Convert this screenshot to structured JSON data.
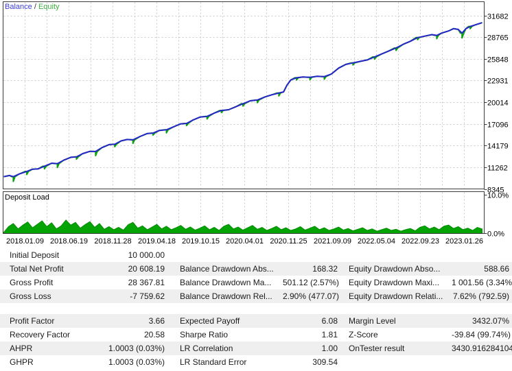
{
  "legend": {
    "balance": "Balance",
    "separator": " / ",
    "equity": "Equity"
  },
  "deposit_panel": {
    "label": "Deposit Load",
    "axis_max_label": "10.0%",
    "axis_min_label": "0.0%"
  },
  "colors": {
    "balance_line": "#2525c8",
    "equity_line": "#0ba30b",
    "deposit_fill": "#04a404",
    "deposit_edge": "#078a07",
    "grid": "#c9c9c9",
    "border": "#3a3a3a",
    "axis_text": "#000000",
    "legend_balance": "#3a3ad9",
    "legend_equity": "#3fae3f",
    "row_alt_bg": "#efefef"
  },
  "chart_data": {
    "type": "line",
    "title": "Balance / Equity",
    "legend": [
      "Balance",
      "Equity"
    ],
    "legend_position": "top-left",
    "grid": "on",
    "y_ticks": [
      31682,
      28765,
      25848,
      22931,
      20014,
      17096,
      14179,
      11262,
      8345
    ],
    "y_range": [
      8345,
      31682
    ],
    "x_tick_dates": [
      "2018.01.09",
      "2018.06.19",
      "2018.11.28",
      "2019.04.18",
      "2019.10.15",
      "2020.04.01",
      "2020.11.25",
      "2021.09.09",
      "2022.05.04",
      "2022.09.23",
      "2023.01.26"
    ],
    "initial_value": 10000,
    "final_balance": 30608,
    "balance_points": [
      [
        0,
        10000
      ],
      [
        0.012,
        10150
      ],
      [
        0.02,
        10000
      ],
      [
        0.032,
        10350
      ],
      [
        0.048,
        10700
      ],
      [
        0.06,
        11000
      ],
      [
        0.072,
        11050
      ],
      [
        0.085,
        11400
      ],
      [
        0.1,
        11800
      ],
      [
        0.112,
        11750
      ],
      [
        0.125,
        12200
      ],
      [
        0.14,
        12600
      ],
      [
        0.152,
        12650
      ],
      [
        0.165,
        13100
      ],
      [
        0.18,
        13400
      ],
      [
        0.192,
        13380
      ],
      [
        0.205,
        13900
      ],
      [
        0.22,
        14300
      ],
      [
        0.232,
        14350
      ],
      [
        0.245,
        14800
      ],
      [
        0.258,
        15000
      ],
      [
        0.27,
        14950
      ],
      [
        0.285,
        15400
      ],
      [
        0.3,
        15800
      ],
      [
        0.312,
        15850
      ],
      [
        0.325,
        16200
      ],
      [
        0.34,
        16300
      ],
      [
        0.355,
        16700
      ],
      [
        0.37,
        17100
      ],
      [
        0.382,
        17150
      ],
      [
        0.395,
        17600
      ],
      [
        0.41,
        18000
      ],
      [
        0.425,
        18100
      ],
      [
        0.44,
        18550
      ],
      [
        0.455,
        18900
      ],
      [
        0.47,
        19000
      ],
      [
        0.485,
        19400
      ],
      [
        0.5,
        19800
      ],
      [
        0.515,
        20200
      ],
      [
        0.53,
        20300
      ],
      [
        0.545,
        20700
      ],
      [
        0.56,
        21000
      ],
      [
        0.575,
        21250
      ],
      [
        0.585,
        21400
      ],
      [
        0.592,
        22300
      ],
      [
        0.6,
        23000
      ],
      [
        0.612,
        23300
      ],
      [
        0.625,
        23400
      ],
      [
        0.64,
        23350
      ],
      [
        0.655,
        23500
      ],
      [
        0.67,
        23450
      ],
      [
        0.685,
        23800
      ],
      [
        0.7,
        24600
      ],
      [
        0.715,
        25100
      ],
      [
        0.73,
        25300
      ],
      [
        0.745,
        25500
      ],
      [
        0.76,
        25700
      ],
      [
        0.775,
        26100
      ],
      [
        0.79,
        26500
      ],
      [
        0.805,
        26900
      ],
      [
        0.82,
        27300
      ],
      [
        0.835,
        27800
      ],
      [
        0.85,
        28200
      ],
      [
        0.865,
        28700
      ],
      [
        0.88,
        28900
      ],
      [
        0.895,
        29100
      ],
      [
        0.905,
        29000
      ],
      [
        0.915,
        29300
      ],
      [
        0.93,
        29600
      ],
      [
        0.94,
        29900
      ],
      [
        0.95,
        29800
      ],
      [
        0.958,
        29300
      ],
      [
        0.966,
        29900
      ],
      [
        0.975,
        30200
      ],
      [
        0.985,
        30400
      ],
      [
        1,
        30700
      ]
    ],
    "equity_dips": [
      [
        0.02,
        650
      ],
      [
        0.048,
        420
      ],
      [
        0.085,
        350
      ],
      [
        0.112,
        520
      ],
      [
        0.152,
        300
      ],
      [
        0.192,
        560
      ],
      [
        0.232,
        320
      ],
      [
        0.27,
        480
      ],
      [
        0.312,
        260
      ],
      [
        0.34,
        420
      ],
      [
        0.382,
        300
      ],
      [
        0.425,
        350
      ],
      [
        0.455,
        280
      ],
      [
        0.5,
        300
      ],
      [
        0.53,
        350
      ],
      [
        0.575,
        400
      ],
      [
        0.612,
        300
      ],
      [
        0.64,
        320
      ],
      [
        0.67,
        350
      ],
      [
        0.73,
        280
      ],
      [
        0.775,
        300
      ],
      [
        0.82,
        320
      ],
      [
        0.865,
        280
      ],
      [
        0.905,
        450
      ],
      [
        0.958,
        650
      ],
      [
        0.975,
        300
      ]
    ],
    "deposit_load": {
      "label": "Deposit Load",
      "axis_max_label": "10.0%",
      "axis_min_label": "0.0%",
      "axis_range_pct": [
        0,
        10
      ],
      "step": 0.01,
      "values_pct": [
        0.3,
        1.8,
        2.6,
        1.2,
        2.2,
        3.0,
        1.5,
        2.4,
        3.3,
        1.8,
        2.8,
        1.2,
        2.0,
        3.5,
        2.2,
        2.9,
        1.4,
        2.3,
        3.1,
        1.6,
        2.6,
        1.1,
        1.8,
        1.0,
        1.6,
        0.9,
        2.3,
        2.9,
        1.4,
        2.0,
        1.0,
        1.7,
        2.4,
        1.2,
        1.9,
        1.0,
        1.5,
        2.1,
        1.1,
        1.7,
        0.9,
        1.4,
        2.0,
        1.0,
        1.6,
        0.8,
        1.9,
        2.4,
        1.2,
        1.7,
        0.9,
        1.5,
        2.1,
        1.1,
        1.6,
        0.8,
        1.3,
        1.9,
        1.0,
        1.5,
        0.8,
        1.2,
        1.8,
        0.9,
        1.4,
        1.9,
        1.0,
        1.5,
        0.8,
        1.2,
        1.7,
        0.9,
        1.3,
        0.7,
        1.1,
        1.5,
        0.8,
        1.2,
        0.6,
        1.0,
        1.4,
        0.8,
        1.1,
        0.6,
        1.0,
        1.3,
        0.7,
        1.6,
        2.0,
        1.2,
        1.7,
        1.0,
        1.9,
        2.2,
        1.3,
        1.8,
        1.0,
        1.4,
        0.8,
        1.6,
        1.2
      ]
    }
  },
  "stats": {
    "rows": [
      {
        "cells": [
          {
            "label": "Initial Deposit",
            "value": "10 000.00"
          },
          {
            "label": "",
            "value": ""
          },
          {
            "label": "",
            "value": ""
          }
        ]
      },
      {
        "cells": [
          {
            "label": "Total Net Profit",
            "value": "20 608.19"
          },
          {
            "label": "Balance Drawdown Abs...",
            "value": "168.32"
          },
          {
            "label": "Equity Drawdown Abso...",
            "value": "588.66"
          }
        ]
      },
      {
        "cells": [
          {
            "label": "Gross Profit",
            "value": "28 367.81"
          },
          {
            "label": "Balance Drawdown Ma...",
            "value": "501.12 (2.57%)"
          },
          {
            "label": "Equity Drawdown Maxi...",
            "value": "1 001.56 (3.34%)"
          }
        ]
      },
      {
        "cells": [
          {
            "label": "Gross Loss",
            "value": "-7 759.62"
          },
          {
            "label": "Balance Drawdown Rel...",
            "value": "2.90% (477.07)"
          },
          {
            "label": "Equity Drawdown Relati...",
            "value": "7.62% (792.59)"
          }
        ]
      },
      {
        "cells": [
          {
            "label": "Profit Factor",
            "value": "3.66"
          },
          {
            "label": "Expected Payoff",
            "value": "6.08"
          },
          {
            "label": "Margin Level",
            "value": "3432.07%"
          }
        ]
      },
      {
        "cells": [
          {
            "label": "Recovery Factor",
            "value": "20.58"
          },
          {
            "label": "Sharpe Ratio",
            "value": "1.81"
          },
          {
            "label": "Z-Score",
            "value": "-39.84 (99.74%)"
          }
        ]
      },
      {
        "cells": [
          {
            "label": "AHPR",
            "value": "1.0003 (0.03%)"
          },
          {
            "label": "LR Correlation",
            "value": "1.00"
          },
          {
            "label": "OnTester result",
            "value": "3430.916284104..."
          }
        ]
      },
      {
        "cells": [
          {
            "label": "GHPR",
            "value": "1.0003 (0.03%)"
          },
          {
            "label": "LR Standard Error",
            "value": "309.54"
          },
          {
            "label": "",
            "value": ""
          }
        ]
      }
    ]
  }
}
